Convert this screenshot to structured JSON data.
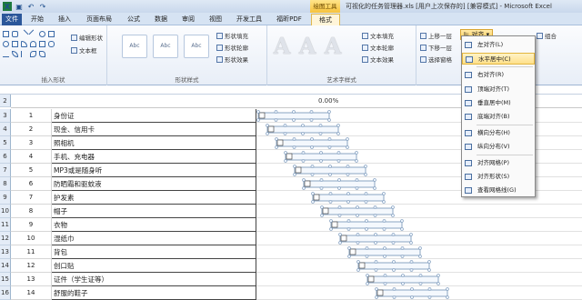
{
  "titlebar": {
    "title": "可视化的任务管理器.xls [用户上次保存的] [兼容模式] - Microsoft Excel",
    "drawing_tools": "绘图工具",
    "qat_icons": [
      "excel-icon",
      "save-icon",
      "undo-icon",
      "redo-icon"
    ]
  },
  "tabs": [
    {
      "label": "文件"
    },
    {
      "label": "开始"
    },
    {
      "label": "插入"
    },
    {
      "label": "页面布局"
    },
    {
      "label": "公式"
    },
    {
      "label": "数据"
    },
    {
      "label": "审阅"
    },
    {
      "label": "视图"
    },
    {
      "label": "开发工具"
    },
    {
      "label": "福昕PDF"
    },
    {
      "label": "格式"
    }
  ],
  "ribbon": {
    "insert_shapes": {
      "label": "插入形状",
      "edit_shape": "编辑形状",
      "text_box": "文本框"
    },
    "shape_styles": {
      "label": "形状样式",
      "samples": [
        "Abc",
        "Abc",
        "Abc"
      ],
      "fill": "形状填充",
      "outline": "形状轮廓",
      "effects": "形状效果"
    },
    "wordart": {
      "label": "艺术字样式",
      "letters": [
        "A",
        "A",
        "A"
      ],
      "text_fill": "文本填充",
      "text_outline": "文本轮廓",
      "text_effects": "文本效果"
    },
    "arrange": {
      "bring_forward": "上移一层",
      "send_backward": "下移一层",
      "selection_pane": "选择窗格",
      "align_button": "对齐",
      "group": "组合"
    }
  },
  "sheet": {
    "header_row_num": "2",
    "header_value": "0.00%",
    "rows": [
      {
        "num": "3",
        "id": "1",
        "task": "身份证"
      },
      {
        "num": "4",
        "id": "2",
        "task": "现金、信用卡"
      },
      {
        "num": "5",
        "id": "3",
        "task": "照相机"
      },
      {
        "num": "6",
        "id": "4",
        "task": "手机、充电器"
      },
      {
        "num": "7",
        "id": "5",
        "task": "MP3或是随身听"
      },
      {
        "num": "8",
        "id": "6",
        "task": "防晒霜和驱蚊液"
      },
      {
        "num": "9",
        "id": "7",
        "task": "护发素"
      },
      {
        "num": "10",
        "id": "8",
        "task": "帽子"
      },
      {
        "num": "11",
        "id": "9",
        "task": "衣物"
      },
      {
        "num": "12",
        "id": "10",
        "task": "湿纸巾"
      },
      {
        "num": "13",
        "id": "11",
        "task": "背包"
      },
      {
        "num": "14",
        "id": "12",
        "task": "创口贴"
      },
      {
        "num": "15",
        "id": "13",
        "task": "证件（学生证等）"
      },
      {
        "num": "16",
        "id": "14",
        "task": "舒服的鞋子"
      }
    ]
  },
  "align_menu": {
    "items": [
      {
        "label": "左对齐(L)",
        "icon": "align-left-icon"
      },
      {
        "label": "水平居中(C)",
        "icon": "align-center-icon"
      },
      {
        "label": "右对齐(R)",
        "icon": "align-right-icon"
      },
      {
        "label": "顶端对齐(T)",
        "icon": "align-top-icon"
      },
      {
        "label": "垂直居中(M)",
        "icon": "align-middle-icon"
      },
      {
        "label": "底端对齐(B)",
        "icon": "align-bottom-icon"
      },
      {
        "label": "横向分布(H)",
        "icon": "distribute-horizontal-icon"
      },
      {
        "label": "纵向分布(V)",
        "icon": "distribute-vertical-icon"
      },
      {
        "label": "对齐网格(P)",
        "icon": "snap-grid-icon"
      },
      {
        "label": "对齐形状(S)",
        "icon": "snap-shape-icon"
      },
      {
        "label": "查看网格线(G)",
        "icon": "view-gridlines-icon"
      }
    ],
    "highlighted_index": 1
  }
}
